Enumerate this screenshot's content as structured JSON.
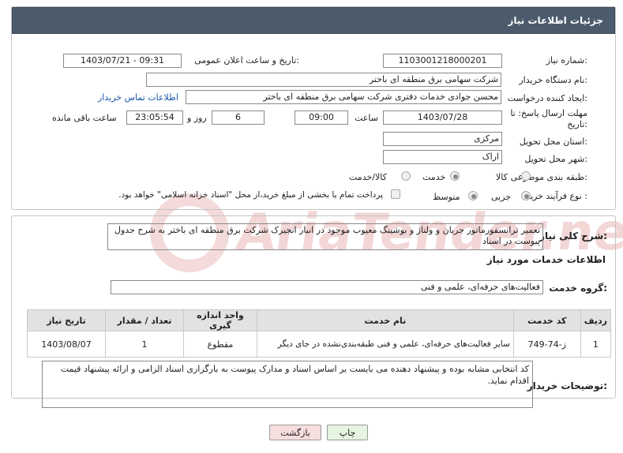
{
  "header": {
    "title": "جزئیات اطلاعات نیاز"
  },
  "form": {
    "need_number_label": "شماره نیاز:",
    "need_number": "1103001218000201",
    "announce_label": "تاریخ و ساعت اعلان عمومی:",
    "announce_value": "1403/07/21 - 09:31",
    "buyer_label": "نام دستگاه خریدار:",
    "buyer_value": "شرکت سهامی برق منطقه ای باختر",
    "creator_label": "ایجاد کننده درخواست:",
    "creator_value": "محسن جوادی خدمات دفتری شرکت سهامی برق منطقه ای باختر",
    "contact_link": "اطلاعات تماس خریدار",
    "deadline_label_1": "مهلت ارسال پاسخ: تا",
    "deadline_label_2": "تاریخ:",
    "deadline_date": "1403/07/28",
    "time_label": "ساعت",
    "deadline_time": "09:00",
    "days_value": "6",
    "days_label": "روز و",
    "remaining_time": "23:05:54",
    "remaining_label": "ساعت باقی مانده",
    "province_label": "استان محل تحویل:",
    "province_value": "مرکزی",
    "city_label": "شهر محل تحویل:",
    "city_value": "اراک",
    "category_label": "طبقه بندی موضوعی:",
    "category_options": [
      "کالا",
      "خدمت",
      "کالا/خدمت"
    ],
    "category_selected": "خدمت",
    "process_label": "نوع فرآیند خرید :",
    "process_options": [
      "جزیی",
      "متوسط"
    ],
    "process_selected": "جزیی",
    "payment_note": "پرداخت تمام یا بخشی از مبلغ خرید،از محل \"اسناد خزانه اسلامی\" خواهد بود."
  },
  "description": {
    "label": "شرح کلی نیاز:",
    "text": "تعمیر ترانسفورماتور جریان و ولتاژ و بوشینگ معیوب موجود در انبار انجیرک شرکت برق منطقه ای باختر به شرح جدول پیوست در اسناد"
  },
  "services": {
    "section_title": "اطلاعات خدمات مورد نیاز",
    "group_label": "گروه خدمت:",
    "group_value": "فعالیت‌های حرفه‌ای، علمی و فنی",
    "columns": [
      "ردیف",
      "کد خدمت",
      "نام خدمت",
      "واحد اندازه گیری",
      "تعداد / مقدار",
      "تاریخ نیاز"
    ],
    "rows": [
      {
        "index": "1",
        "code": "ز-74-749",
        "name": "سایر فعالیت‌های حرفه‌ای، علمی و فنی طبقه‌بندی‌نشده در جای دیگر",
        "unit": "مقطوع",
        "qty": "1",
        "date": "1403/08/07"
      }
    ]
  },
  "notes": {
    "label": "توضیحات خریدار:",
    "text": "کد انتخابی مشابه بوده و پیشنهاد دهنده می بایست بر اساس اسناد و مدارک پیوست به بارگزاری اسناد الزامی و ارائه پیشنهاد قیمت اقدام نماید."
  },
  "buttons": {
    "print": "چاپ",
    "back": "بازگشت"
  },
  "watermark": {
    "text": "AriaTender.neT"
  },
  "colors": {
    "header_bg": "#4b5b6c",
    "link": "#1a55a8",
    "back_button": "#f7dede",
    "print_button": "#e6f4e2"
  }
}
